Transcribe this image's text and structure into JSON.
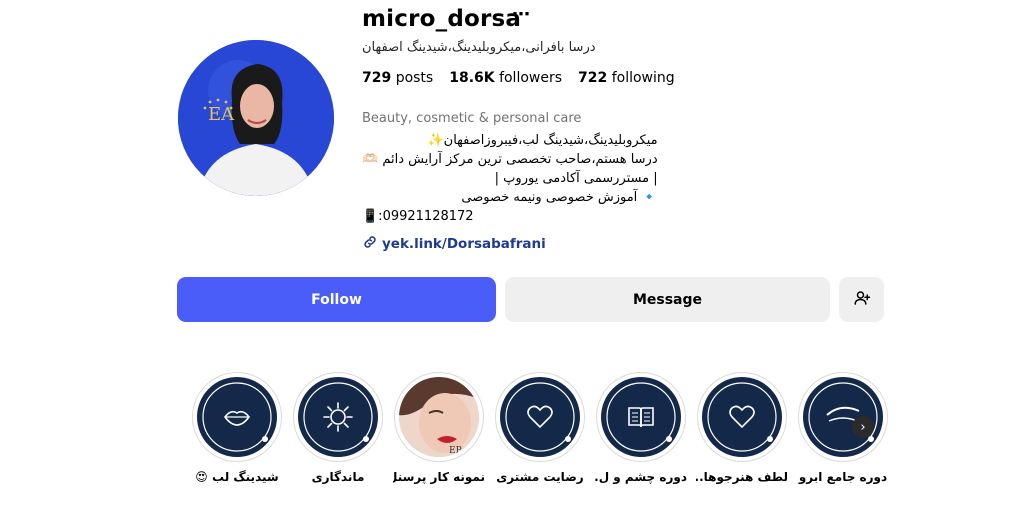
{
  "profile": {
    "username": "micro_dorsa",
    "more_icon": "⋯",
    "full_name": "درسا بافرانی،میکروبلیدینگ،شیدینگ اصفهان",
    "stats": {
      "posts_count": "729",
      "posts_label": "posts",
      "followers_count": "18.6K",
      "followers_label": "followers",
      "following_count": "722",
      "following_label": "following"
    },
    "category": "Beauty, cosmetic & personal care",
    "bio_lines": [
      "میکروبلیدینگ،شیدینگ لب،فیبروزاصفهان✨",
      "درسا هستم،صاحب تخصصی ترین مرکز آرایش دائم 🫶🏻",
      "| مستررسمی آکادمی یوروپ |",
      "🔹 آموزش خصوصی ونیمه خصوصی",
      "📱:09921128172"
    ],
    "link_text": "yek.link/Dorsabafrani"
  },
  "actions": {
    "follow_label": "Follow",
    "message_label": "Message",
    "add_user_icon": "person-add-icon"
  },
  "highlights": [
    {
      "label": "شیدینگ لب 😍",
      "icon": "lips-icon"
    },
    {
      "label": "ماندگاری",
      "icon": "sun-icon"
    },
    {
      "label": "نمونه کار پرسنل",
      "icon": "photo"
    },
    {
      "label": "رضایت مشتری",
      "icon": "heart-icon"
    },
    {
      "label": "دوره چشم و ل...",
      "icon": "book-icon"
    },
    {
      "label": "لطف هنرجوها...",
      "icon": "heart-icon"
    },
    {
      "label": "دوره جامع ابرو",
      "icon": "eyebrow-icon"
    }
  ],
  "colors": {
    "follow_button": "#4a5df9",
    "highlight_bg": "#14284a",
    "link": "#1f3a93"
  }
}
